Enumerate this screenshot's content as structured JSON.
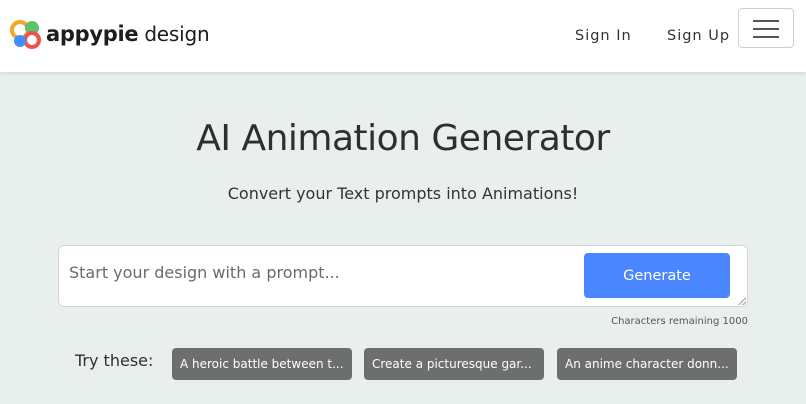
{
  "header": {
    "logo_brand": "appypie",
    "logo_sub": "design",
    "sign_in": "Sign In",
    "sign_up": "Sign Up",
    "menu_icon": "hamburger-menu-icon"
  },
  "main": {
    "title": "AI Animation Generator",
    "subtitle": "Convert your Text prompts into Animations!",
    "prompt_placeholder": "Start your design with a prompt...",
    "prompt_value": "",
    "generate_label": "Generate",
    "char_count": "Characters remaining 1000",
    "try_label": "Try these:",
    "suggestions": [
      "A heroic battle between t...",
      "Create a picturesque gar...",
      "An anime character donn..."
    ]
  },
  "colors": {
    "page_bg": "#e9efec",
    "accent": "#4a86ff",
    "chip_bg": "#6d6e6e",
    "logo_orange": "#f5a623",
    "logo_green": "#5cc46a",
    "logo_red": "#ef5350",
    "logo_blue": "#3f8efc"
  }
}
